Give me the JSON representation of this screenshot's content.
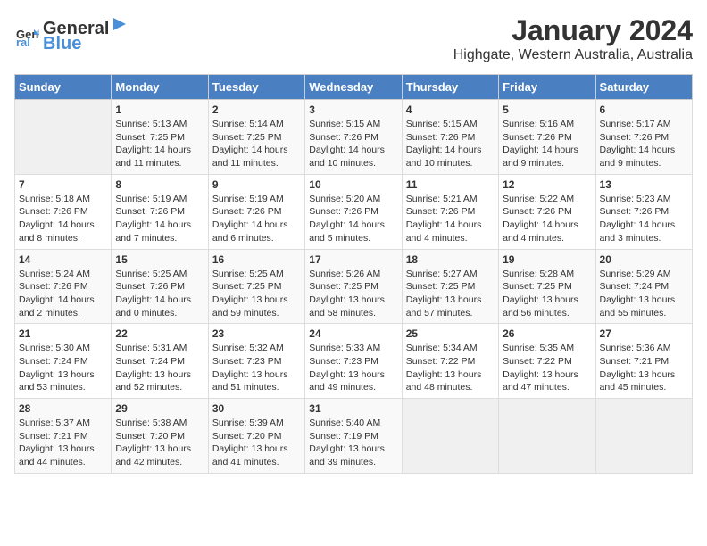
{
  "logo": {
    "general": "General",
    "blue": "Blue"
  },
  "title": "January 2024",
  "subtitle": "Highgate, Western Australia, Australia",
  "headers": [
    "Sunday",
    "Monday",
    "Tuesday",
    "Wednesday",
    "Thursday",
    "Friday",
    "Saturday"
  ],
  "weeks": [
    [
      {
        "day": "",
        "info": ""
      },
      {
        "day": "1",
        "info": "Sunrise: 5:13 AM\nSunset: 7:25 PM\nDaylight: 14 hours\nand 11 minutes."
      },
      {
        "day": "2",
        "info": "Sunrise: 5:14 AM\nSunset: 7:25 PM\nDaylight: 14 hours\nand 11 minutes."
      },
      {
        "day": "3",
        "info": "Sunrise: 5:15 AM\nSunset: 7:26 PM\nDaylight: 14 hours\nand 10 minutes."
      },
      {
        "day": "4",
        "info": "Sunrise: 5:15 AM\nSunset: 7:26 PM\nDaylight: 14 hours\nand 10 minutes."
      },
      {
        "day": "5",
        "info": "Sunrise: 5:16 AM\nSunset: 7:26 PM\nDaylight: 14 hours\nand 9 minutes."
      },
      {
        "day": "6",
        "info": "Sunrise: 5:17 AM\nSunset: 7:26 PM\nDaylight: 14 hours\nand 9 minutes."
      }
    ],
    [
      {
        "day": "7",
        "info": "Sunrise: 5:18 AM\nSunset: 7:26 PM\nDaylight: 14 hours\nand 8 minutes."
      },
      {
        "day": "8",
        "info": "Sunrise: 5:19 AM\nSunset: 7:26 PM\nDaylight: 14 hours\nand 7 minutes."
      },
      {
        "day": "9",
        "info": "Sunrise: 5:19 AM\nSunset: 7:26 PM\nDaylight: 14 hours\nand 6 minutes."
      },
      {
        "day": "10",
        "info": "Sunrise: 5:20 AM\nSunset: 7:26 PM\nDaylight: 14 hours\nand 5 minutes."
      },
      {
        "day": "11",
        "info": "Sunrise: 5:21 AM\nSunset: 7:26 PM\nDaylight: 14 hours\nand 4 minutes."
      },
      {
        "day": "12",
        "info": "Sunrise: 5:22 AM\nSunset: 7:26 PM\nDaylight: 14 hours\nand 4 minutes."
      },
      {
        "day": "13",
        "info": "Sunrise: 5:23 AM\nSunset: 7:26 PM\nDaylight: 14 hours\nand 3 minutes."
      }
    ],
    [
      {
        "day": "14",
        "info": "Sunrise: 5:24 AM\nSunset: 7:26 PM\nDaylight: 14 hours\nand 2 minutes."
      },
      {
        "day": "15",
        "info": "Sunrise: 5:25 AM\nSunset: 7:26 PM\nDaylight: 14 hours\nand 0 minutes."
      },
      {
        "day": "16",
        "info": "Sunrise: 5:25 AM\nSunset: 7:25 PM\nDaylight: 13 hours\nand 59 minutes."
      },
      {
        "day": "17",
        "info": "Sunrise: 5:26 AM\nSunset: 7:25 PM\nDaylight: 13 hours\nand 58 minutes."
      },
      {
        "day": "18",
        "info": "Sunrise: 5:27 AM\nSunset: 7:25 PM\nDaylight: 13 hours\nand 57 minutes."
      },
      {
        "day": "19",
        "info": "Sunrise: 5:28 AM\nSunset: 7:25 PM\nDaylight: 13 hours\nand 56 minutes."
      },
      {
        "day": "20",
        "info": "Sunrise: 5:29 AM\nSunset: 7:24 PM\nDaylight: 13 hours\nand 55 minutes."
      }
    ],
    [
      {
        "day": "21",
        "info": "Sunrise: 5:30 AM\nSunset: 7:24 PM\nDaylight: 13 hours\nand 53 minutes."
      },
      {
        "day": "22",
        "info": "Sunrise: 5:31 AM\nSunset: 7:24 PM\nDaylight: 13 hours\nand 52 minutes."
      },
      {
        "day": "23",
        "info": "Sunrise: 5:32 AM\nSunset: 7:23 PM\nDaylight: 13 hours\nand 51 minutes."
      },
      {
        "day": "24",
        "info": "Sunrise: 5:33 AM\nSunset: 7:23 PM\nDaylight: 13 hours\nand 49 minutes."
      },
      {
        "day": "25",
        "info": "Sunrise: 5:34 AM\nSunset: 7:22 PM\nDaylight: 13 hours\nand 48 minutes."
      },
      {
        "day": "26",
        "info": "Sunrise: 5:35 AM\nSunset: 7:22 PM\nDaylight: 13 hours\nand 47 minutes."
      },
      {
        "day": "27",
        "info": "Sunrise: 5:36 AM\nSunset: 7:21 PM\nDaylight: 13 hours\nand 45 minutes."
      }
    ],
    [
      {
        "day": "28",
        "info": "Sunrise: 5:37 AM\nSunset: 7:21 PM\nDaylight: 13 hours\nand 44 minutes."
      },
      {
        "day": "29",
        "info": "Sunrise: 5:38 AM\nSunset: 7:20 PM\nDaylight: 13 hours\nand 42 minutes."
      },
      {
        "day": "30",
        "info": "Sunrise: 5:39 AM\nSunset: 7:20 PM\nDaylight: 13 hours\nand 41 minutes."
      },
      {
        "day": "31",
        "info": "Sunrise: 5:40 AM\nSunset: 7:19 PM\nDaylight: 13 hours\nand 39 minutes."
      },
      {
        "day": "",
        "info": ""
      },
      {
        "day": "",
        "info": ""
      },
      {
        "day": "",
        "info": ""
      }
    ]
  ]
}
